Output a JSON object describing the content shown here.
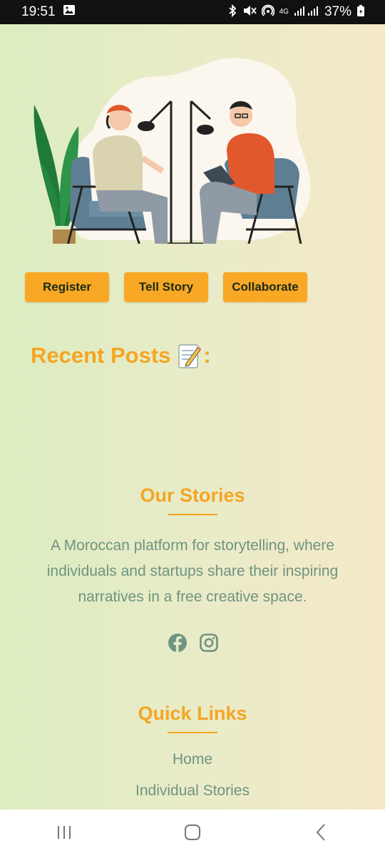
{
  "status": {
    "time": "19:51",
    "network": "4G",
    "battery": "37%"
  },
  "actions": {
    "register": "Register",
    "tell_story": "Tell Story",
    "collaborate": "Collaborate"
  },
  "recent": {
    "title": "Recent Posts",
    "suffix": ":"
  },
  "footer": {
    "stories_title": "Our Stories",
    "about": "A Moroccan platform for storytelling, where individuals and startups share their inspiring narratives in a free creative space.",
    "links_title": "Quick Links",
    "links": [
      "Home",
      "Individual Stories"
    ]
  },
  "icons": {
    "gallery": "gallery-icon",
    "bluetooth": "bluetooth-icon",
    "mute": "mute-icon",
    "hotspot": "hotspot-icon",
    "signal": "signal-icon",
    "battery": "battery-icon",
    "memo": "memo-icon",
    "facebook": "facebook-icon",
    "instagram": "instagram-icon",
    "recents": "recents-icon",
    "home": "home-icon",
    "back": "back-icon"
  },
  "colors": {
    "accent": "#f9a825",
    "title": "#f5a524",
    "text": "#6f9480"
  }
}
